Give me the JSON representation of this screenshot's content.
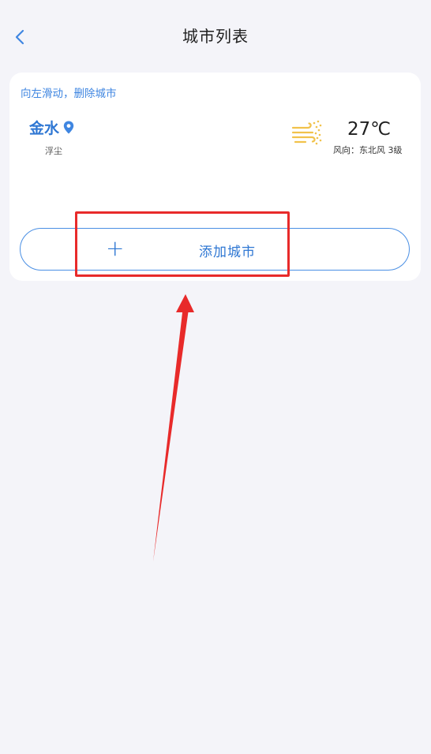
{
  "header": {
    "title": "城市列表",
    "back_icon": "chevron-left-icon"
  },
  "card": {
    "hint": "向左滑动，删除城市",
    "city": {
      "name": "金水",
      "location_icon": "location-pin-icon",
      "condition": "浮尘",
      "weather_icon": "wind-dust-icon",
      "temperature": "27℃",
      "wind": "风向：东北风 3级"
    },
    "add_button": {
      "plus_icon": "+",
      "label": "添加城市"
    }
  },
  "colors": {
    "accent": "#2f77d3",
    "hint": "#3f86e1",
    "background": "#f4f4f9",
    "weather_icon": "#f1c24b",
    "annotation": "#e82a2a"
  }
}
